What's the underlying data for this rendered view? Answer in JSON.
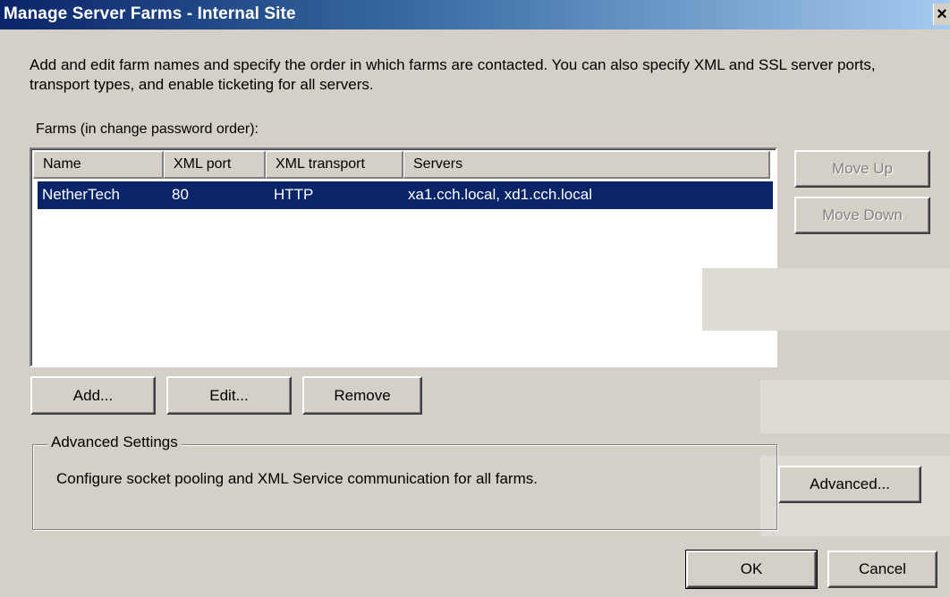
{
  "window": {
    "title": "Manage Server Farms - Internal Site",
    "close_glyph": "×"
  },
  "description": "Add and edit farm names and specify the order in which farms are contacted. You can also specify XML and SSL server ports, transport types, and enable ticketing for all servers.",
  "farms": {
    "label": "Farms (in change password order):",
    "columns": [
      "Name",
      "XML port",
      "XML transport",
      "Servers"
    ],
    "rows": [
      {
        "name": "NetherTech",
        "xml_port": "80",
        "xml_transport": "HTTP",
        "servers": "xa1.cch.local, xd1.cch.local",
        "selected": true
      }
    ]
  },
  "buttons": {
    "move_up": "Move Up",
    "move_down": "Move Down",
    "add": "Add...",
    "edit": "Edit...",
    "remove": "Remove",
    "advanced": "Advanced...",
    "ok": "OK",
    "cancel": "Cancel"
  },
  "advanced_settings": {
    "title": "Advanced Settings",
    "description": "Configure socket pooling and XML Service communication for all farms."
  },
  "colors": {
    "selection": "#0a246a",
    "dialog_face": "#d4d0c8",
    "disabled_text": "#808080"
  }
}
